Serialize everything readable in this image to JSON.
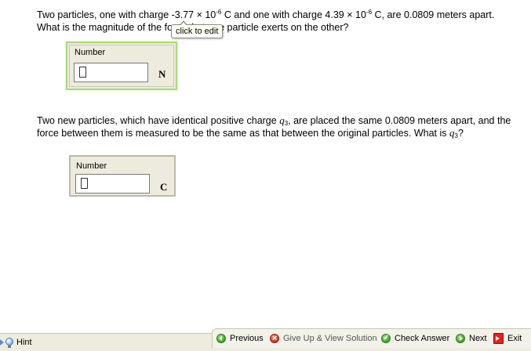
{
  "question1": {
    "line1_a": "Two particles, one with charge -3.77 × 10",
    "exp1": "-6",
    "line1_b": " C and one with charge 4.39 × 10",
    "exp2": "-6",
    "line1_c": " C, are 0.0809 meters apart.",
    "line2": "What is the magnitude of the force that one particle exerts on the other?"
  },
  "tooltip": "click to edit",
  "answer1": {
    "label": "Number",
    "value": "",
    "unit": "N"
  },
  "question2": {
    "text_a": "Two new particles, which have identical positive charge ",
    "var_q": "q",
    "var_sub": "3",
    "text_b": ", are placed the same 0.0809 meters apart, and the force between them is measured to be the same as that between the original particles.  What is ",
    "text_c": "?"
  },
  "answer2": {
    "label": "Number",
    "value": "",
    "unit": "C"
  },
  "footer": {
    "hint": "Hint",
    "previous": "Previous",
    "give_up": "Give Up & View Solution",
    "check": "Check Answer",
    "next": "Next",
    "exit": "Exit"
  }
}
